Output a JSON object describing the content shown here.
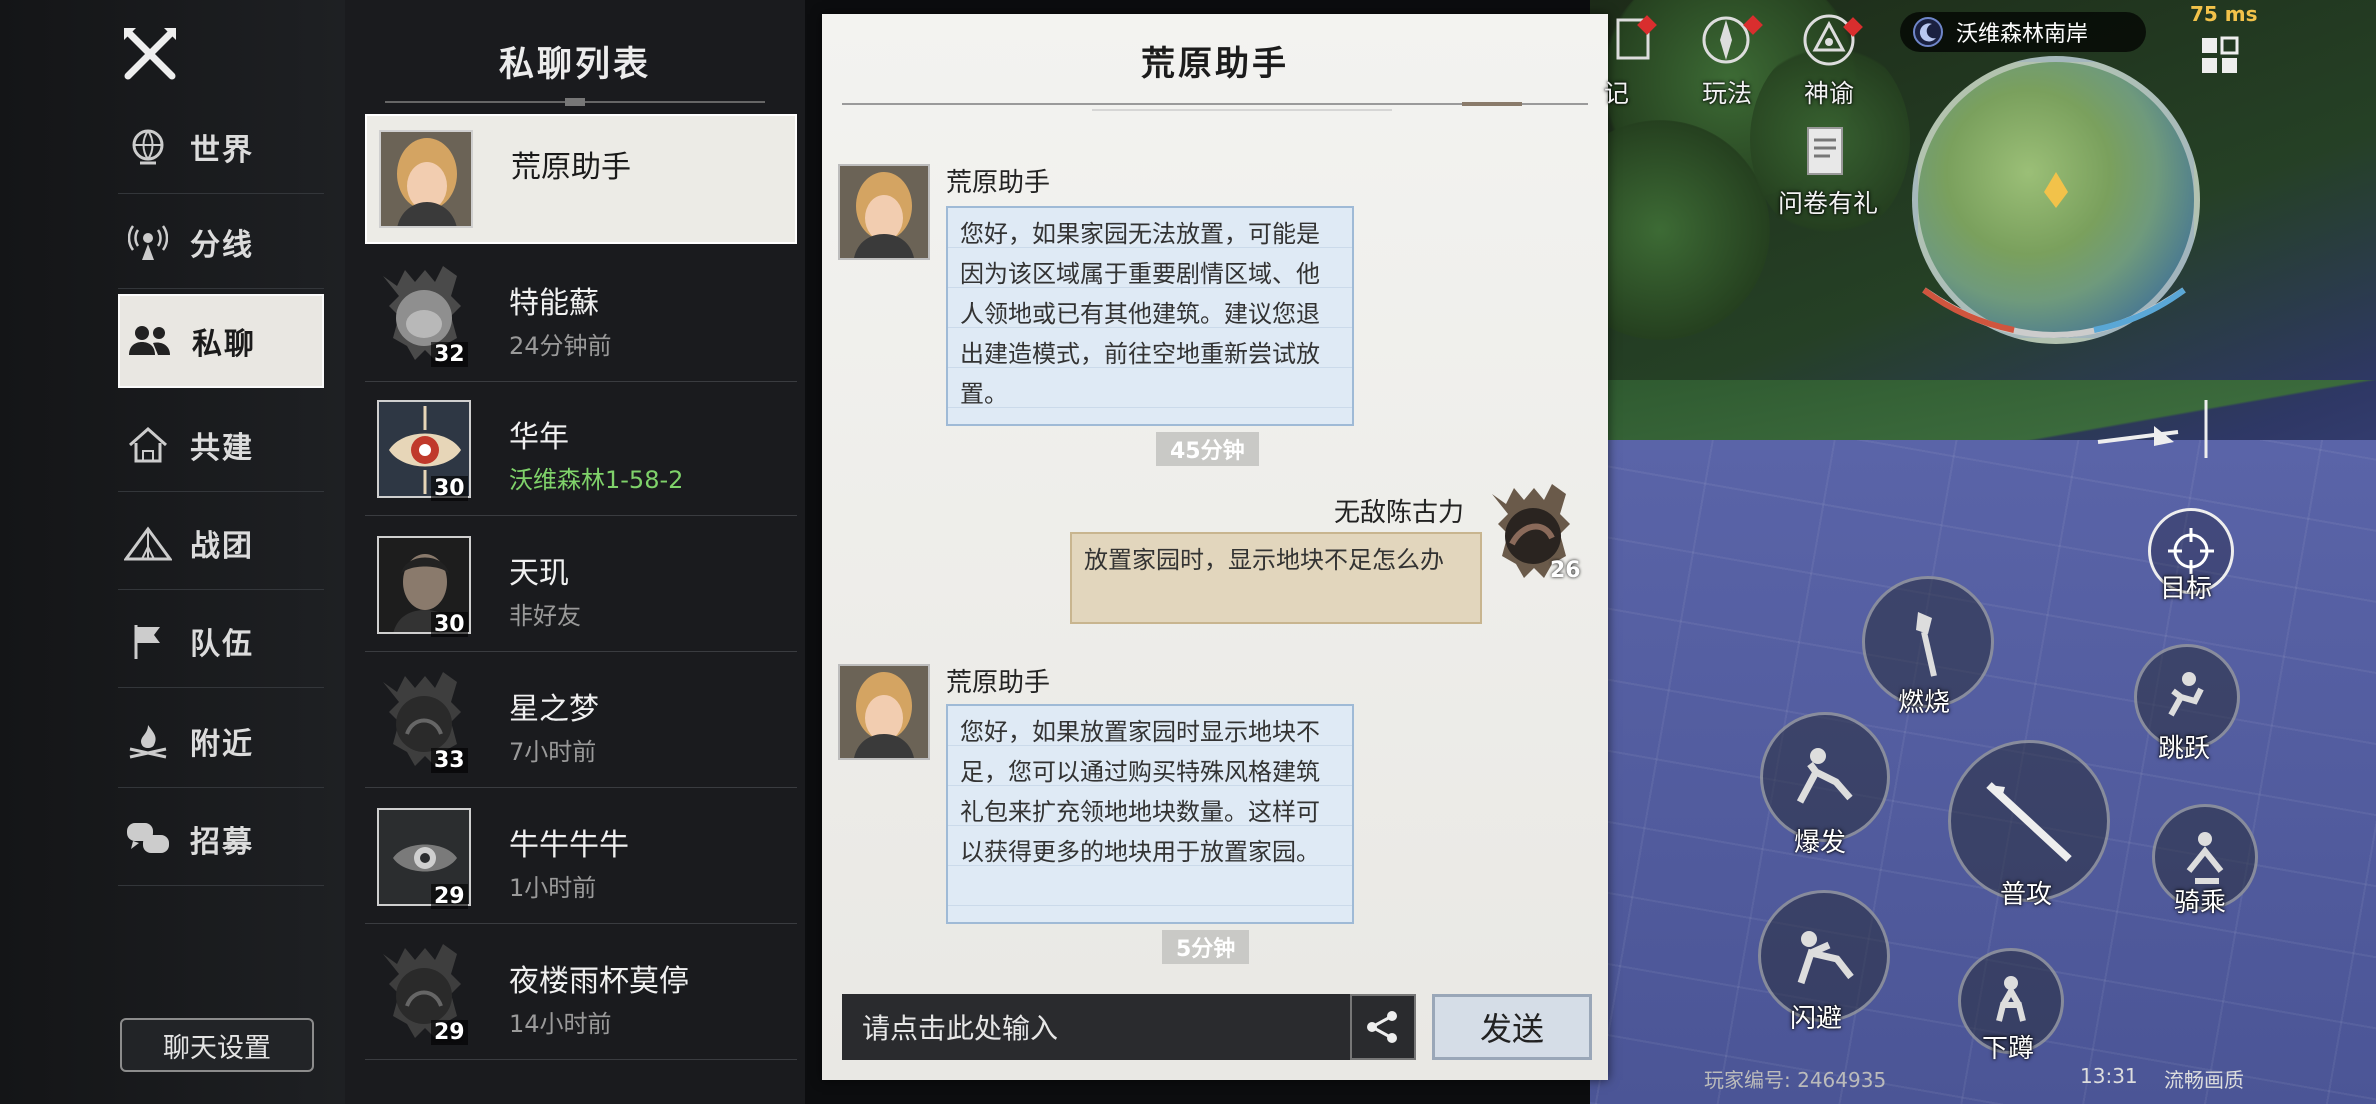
{
  "nav": {
    "items": [
      {
        "label": "世界",
        "icon": "globe-icon"
      },
      {
        "label": "分线",
        "icon": "signal-tower-icon"
      },
      {
        "label": "私聊",
        "icon": "users-icon"
      },
      {
        "label": "共建",
        "icon": "home-build-icon"
      },
      {
        "label": "战团",
        "icon": "tent-icon"
      },
      {
        "label": "队伍",
        "icon": "flag-icon"
      },
      {
        "label": "附近",
        "icon": "campfire-icon"
      },
      {
        "label": "招募",
        "icon": "chat-bubbles-icon"
      }
    ],
    "settings_label": "聊天设置"
  },
  "list": {
    "title": "私聊列表",
    "contacts": [
      {
        "name": "荒原助手",
        "sub": "",
        "level": ""
      },
      {
        "name": "特能蘇",
        "sub": "24分钟前",
        "level": "32"
      },
      {
        "name": "华年",
        "sub": "沃维森林1-58-2",
        "level": "30"
      },
      {
        "name": "天玑",
        "sub": "非好友",
        "level": "30"
      },
      {
        "name": "星之梦",
        "sub": "7小时前",
        "level": "33"
      },
      {
        "name": "牛牛牛牛",
        "sub": "1小时前",
        "level": "29"
      },
      {
        "name": "夜楼雨杯莫停",
        "sub": "14小时前",
        "level": "29"
      }
    ]
  },
  "chat": {
    "title": "荒原助手",
    "messages": [
      {
        "sender": "荒原助手",
        "text": "您好，如果家园无法放置，可能是因为该区域属于重要剧情区域、他人领地或已有其他建筑。建议您退出建造模式，前往空地重新尝试放置。"
      },
      {
        "sender": "无敌陈古力",
        "text": "放置家园时，显示地块不足怎么办",
        "level": "26"
      },
      {
        "sender": "荒原助手",
        "text": "您好，如果放置家园时显示地块不足，您可以通过购买特殊风格建筑礼包来扩充领地地块数量。这样可以获得更多的地块用于放置家园。"
      }
    ],
    "times": [
      "45分钟",
      "5分钟"
    ],
    "input_placeholder": "请点击此处输入",
    "send_label": "发送"
  },
  "hud": {
    "top_icons": [
      {
        "label": "记",
        "icon": "journal-icon"
      },
      {
        "label": "玩法",
        "icon": "compass-icon"
      },
      {
        "label": "神谕",
        "icon": "oracle-eye-icon"
      }
    ],
    "survey_label": "问卷有礼",
    "location": "沃维森林南岸",
    "ping": "75 ms",
    "target_label": "目标",
    "skills": [
      "燃烧",
      "跳跃",
      "爆发",
      "普攻",
      "骑乘",
      "闪避",
      "下蹲"
    ],
    "player_id": "玩家编号: 2464935",
    "time": "13:31",
    "quality": "流畅画质"
  }
}
